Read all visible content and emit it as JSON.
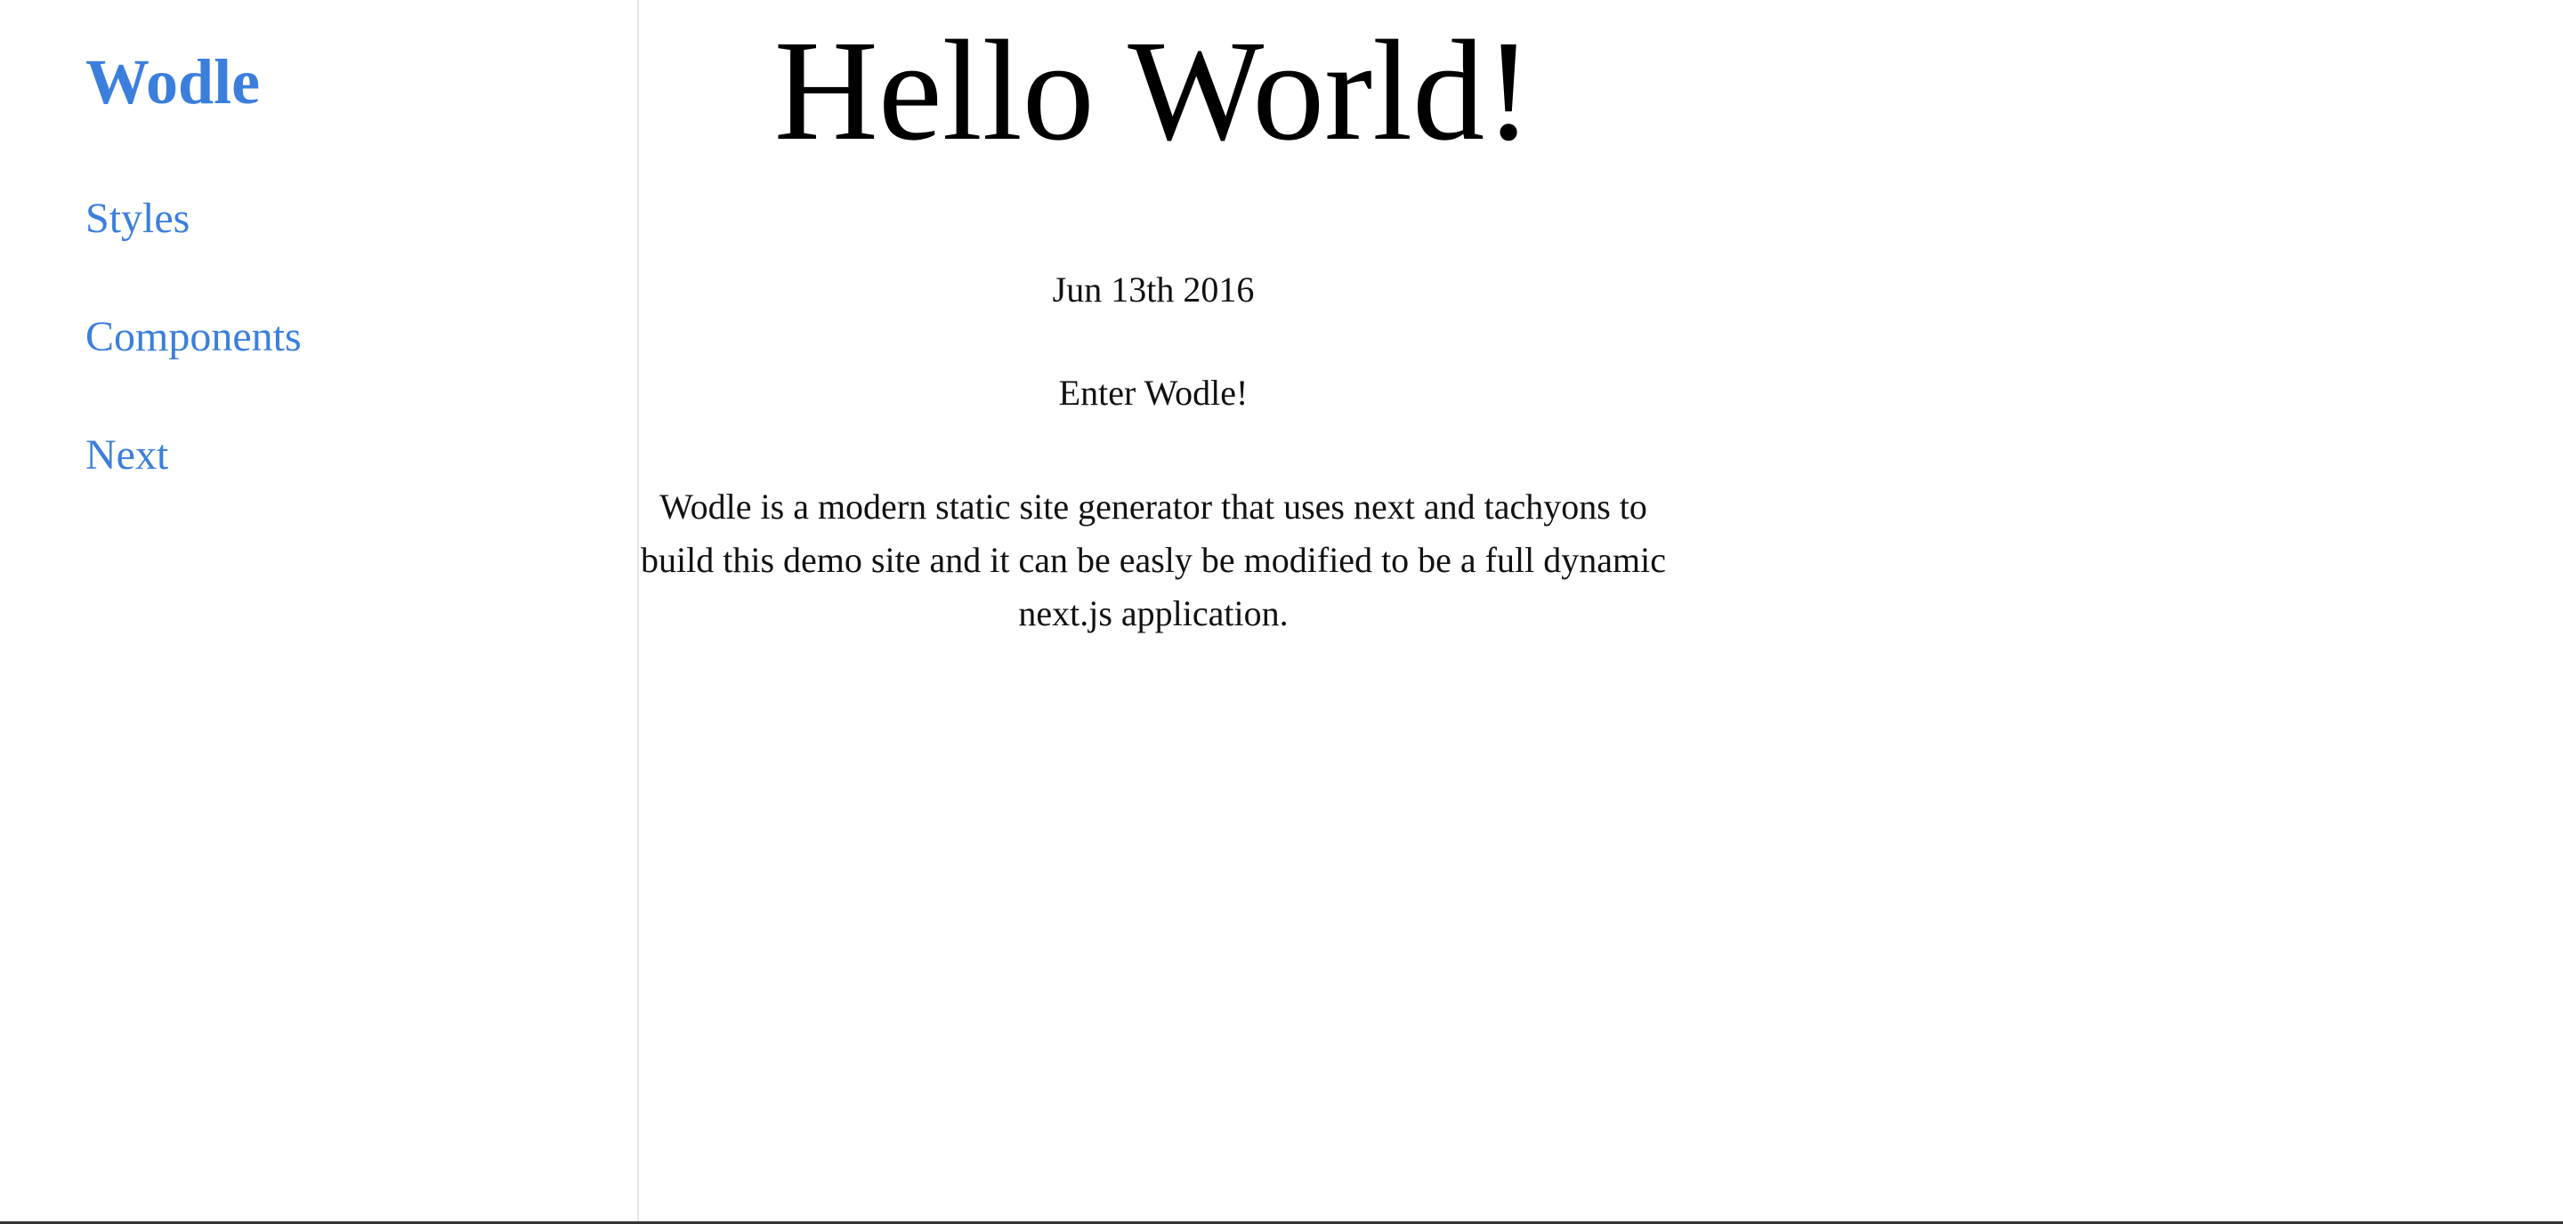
{
  "sidebar": {
    "brand": "Wodle",
    "items": [
      {
        "label": "Styles"
      },
      {
        "label": "Components"
      },
      {
        "label": "Next"
      }
    ]
  },
  "main": {
    "title": "Hello World!",
    "date": "Jun 13th 2016",
    "intro": "Enter Wodle!",
    "body": "Wodle is a modern static site generator that uses next and tachyons to build this demo site and it can be easly be modified to be a full dynamic next.js application."
  },
  "colors": {
    "link": "#3b7fdc",
    "text": "#111111",
    "divider": "#e6e6e6"
  }
}
